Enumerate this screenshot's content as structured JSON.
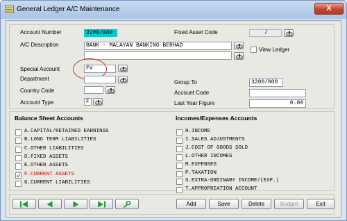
{
  "window": {
    "title": "General Ledger A/C Maintenance",
    "close_label": "X"
  },
  "account": {
    "account_number_label": "Account Number",
    "account_number": "3200/000",
    "description_label": "A/C Description",
    "description_line1": "BANK - MALAYAN BANKING BERHAD",
    "description_line2": "",
    "special_account_label": "Special Account",
    "special_account": "FV",
    "department_label": "Department",
    "department": "",
    "country_code_label": "Country Code",
    "country_code": "",
    "account_type_label": "Account Type",
    "account_type": "F",
    "fixed_asset_code_label": "Fixed Asset Code",
    "fixed_asset_code": "/",
    "view_ledger_label": "View Ledger",
    "group_to_label": "Group To",
    "group_to": "3200/000",
    "account_code_label": "Account Code",
    "account_code": "",
    "last_year_figure_label": "Last Year Figure",
    "last_year_figure": "0.00"
  },
  "balance_sheet": {
    "title": "Balance Sheet Accounts",
    "items": [
      {
        "label": "A.CAPITAL/RETAINED EARNINGS",
        "checked": false,
        "highlight": false
      },
      {
        "label": "B.LONG TERM LIABILITIES",
        "checked": false,
        "highlight": false
      },
      {
        "label": "C.OTHER LIABILITIES",
        "checked": false,
        "highlight": false
      },
      {
        "label": "D.FIXED ASSETS",
        "checked": false,
        "highlight": false
      },
      {
        "label": "E.OTHER ASSETS",
        "checked": false,
        "highlight": false
      },
      {
        "label": "F.CURRENT ASSETS",
        "checked": true,
        "highlight": true
      },
      {
        "label": "G.CURRENT LIABILITIES",
        "checked": false,
        "highlight": false
      }
    ]
  },
  "income_expenses": {
    "title": "Incomes/Expenses Accounts",
    "items": [
      {
        "label": "H.INCOME"
      },
      {
        "label": "I.SALES ADJUSTMENTS"
      },
      {
        "label": "J.COST OF GOODS SOLD"
      },
      {
        "label": "L.OTHER INCOMES"
      },
      {
        "label": "M.EXPENSES"
      },
      {
        "label": "P.TAXATION"
      },
      {
        "label": "S.EXTRA-ORDINARY INCOME/(EXP.)"
      },
      {
        "label": "T.APPROPRIATION ACCOUNT"
      }
    ]
  },
  "toolbar": {
    "nav_icons": [
      "first-record-icon",
      "previous-record-icon",
      "next-record-icon",
      "last-record-icon",
      "search-key-icon"
    ],
    "add_label": "Add",
    "save_label": "Save",
    "delete_label": "Delete",
    "budget_label": "Budget",
    "exit_label": "Exit"
  },
  "colors": {
    "accent_cyan": "#00cccc",
    "nav_green": "#1e9b3a",
    "highlight_red": "#d20000",
    "window_frame": "#d7e4f2"
  }
}
